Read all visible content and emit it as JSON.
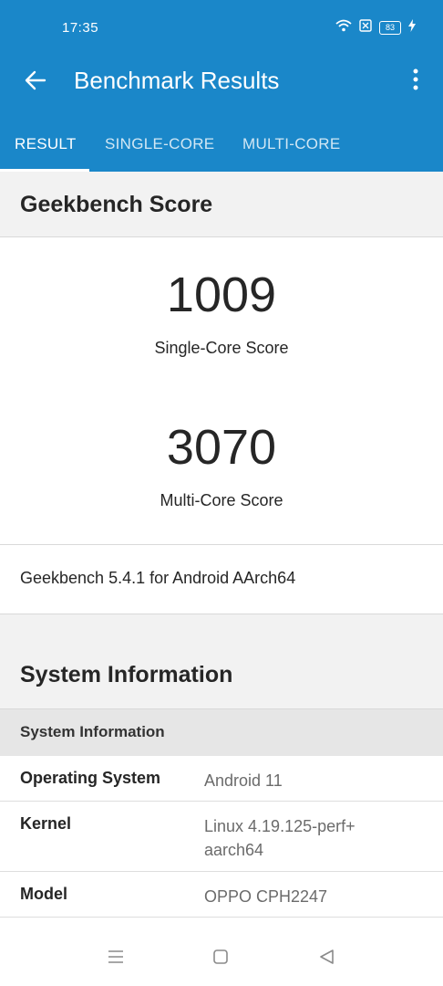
{
  "status": {
    "time": "17:35",
    "battery_level": "83"
  },
  "appbar": {
    "title": "Benchmark Results"
  },
  "tabs": [
    {
      "label": "RESULT",
      "active": true
    },
    {
      "label": "SINGLE-CORE",
      "active": false
    },
    {
      "label": "MULTI-CORE",
      "active": false
    }
  ],
  "score_section": {
    "heading": "Geekbench Score",
    "single_core_score": "1009",
    "single_core_label": "Single-Core Score",
    "multi_core_score": "3070",
    "multi_core_label": "Multi-Core Score"
  },
  "version_text": "Geekbench 5.4.1 for Android AArch64",
  "system_section": {
    "heading": "System Information",
    "subheading": "System Information",
    "rows": [
      {
        "key": "Operating System",
        "value": "Android 11"
      },
      {
        "key": "Kernel",
        "value_line1": "Linux 4.19.125-perf+",
        "value_line2": "aarch64"
      },
      {
        "key": "Model",
        "value": "OPPO CPH2247"
      }
    ]
  },
  "colors": {
    "header_blue": "#1a87c9",
    "section_bg": "#f2f2f2",
    "subhead_bg": "#e6e6e6"
  },
  "icons": {
    "back": "arrow-left-icon",
    "more": "more-vertical-icon",
    "wifi": "wifi-icon",
    "sim": "no-sim-icon",
    "charging": "bolt-icon",
    "nav_menu": "menu-lines-icon",
    "nav_home": "square-icon",
    "nav_back": "triangle-back-icon"
  }
}
